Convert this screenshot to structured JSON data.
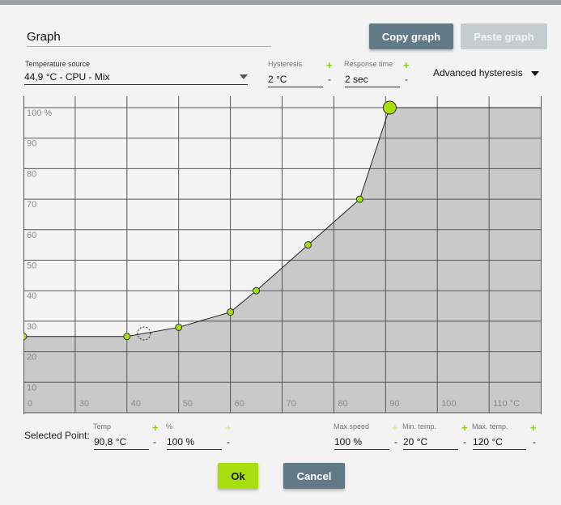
{
  "header": {
    "graph_name": "Graph",
    "copy_graph_label": "Copy graph",
    "paste_graph_label": "Paste graph"
  },
  "settings": {
    "temperature_source_label": "Temperature source",
    "temperature_source_value": "44,9 °C - CPU - Mix",
    "hysteresis_label": "Hysteresis",
    "hysteresis_value": "2 °C",
    "response_time_label": "Response time",
    "response_time_value": "2 sec",
    "advanced_hysteresis_label": "Advanced hysteresis",
    "plus_symbol": "+",
    "minus_symbol": "-"
  },
  "chart_data": {
    "type": "area",
    "x_ticks": [
      "0",
      "30",
      "40",
      "50",
      "60",
      "70",
      "80",
      "90",
      "100",
      "110 °C"
    ],
    "y_ticks": [
      "10",
      "20",
      "30",
      "40",
      "50",
      "60",
      "70",
      "80",
      "90",
      "100 %"
    ],
    "xlim": [
      20,
      120
    ],
    "ylim": [
      0,
      100
    ],
    "points": [
      {
        "x": 20,
        "y": 25
      },
      {
        "x": 40,
        "y": 25
      },
      {
        "x": 50,
        "y": 28
      },
      {
        "x": 60,
        "y": 33
      },
      {
        "x": 65,
        "y": 40
      },
      {
        "x": 75,
        "y": 55
      },
      {
        "x": 85,
        "y": 70
      },
      {
        "x": 90.8,
        "y": 100
      }
    ],
    "selected_index": 7,
    "current_temp_marker": {
      "x": 43.3,
      "y": 26
    },
    "grid": true,
    "colors": {
      "fill": "#c8c9c8",
      "line": "#222222",
      "point": "#a6de0e",
      "grid": "#555555",
      "plot_bg": "#f4f4f4"
    }
  },
  "selected_point": {
    "label": "Selected Point:",
    "temp_label": "Temp",
    "temp_value": "90,8 °C",
    "percent_label": "%",
    "percent_value": "100 %",
    "max_speed_label": "Max speed",
    "max_speed_value": "100 %",
    "min_temp_label": "Min. temp.",
    "min_temp_value": "20 °C",
    "max_temp_label": "Max. temp.",
    "max_temp_value": "120 °C"
  },
  "footer": {
    "ok_label": "Ok",
    "cancel_label": "Cancel"
  }
}
